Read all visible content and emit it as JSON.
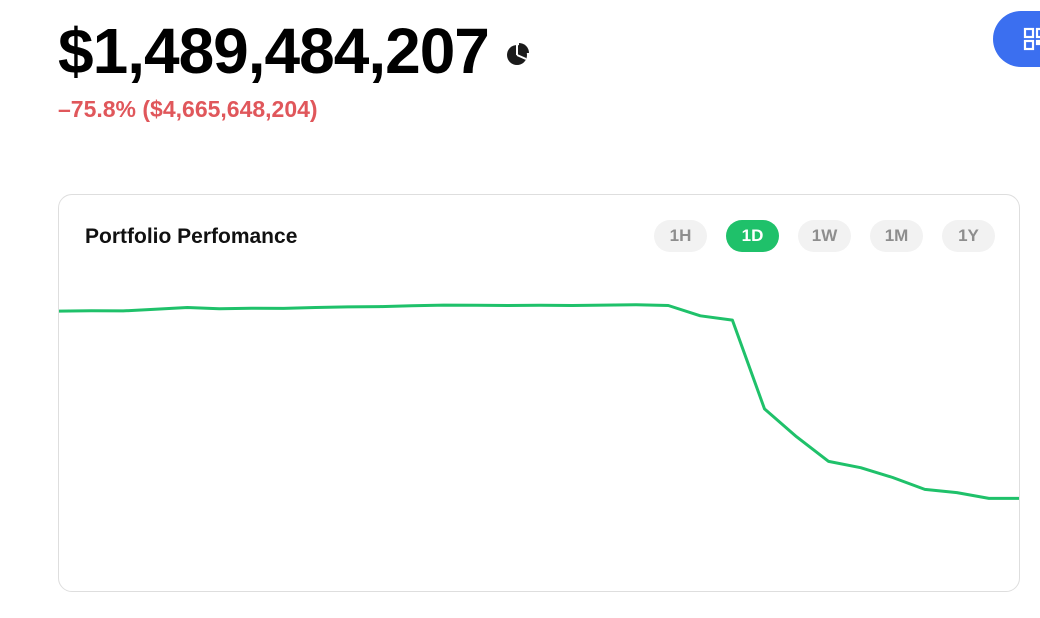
{
  "balance": {
    "value": "$1,489,484,207",
    "change": "–75.8% ($4,665,648,204)",
    "change_color": "#e0575b",
    "breakdown_icon": "pie-chart-icon"
  },
  "qr_button": {
    "icon": "qr-code-icon",
    "color": "#3b6ff0"
  },
  "performance": {
    "title": "Portfolio Perfomance",
    "tabs": [
      {
        "label": "1H",
        "active": false
      },
      {
        "label": "1D",
        "active": true
      },
      {
        "label": "1W",
        "active": false
      },
      {
        "label": "1M",
        "active": false
      },
      {
        "label": "1Y",
        "active": false
      }
    ],
    "active_color": "#1fc16a"
  },
  "chart_data": {
    "type": "line",
    "title": "Portfolio Perfomance",
    "line_color": "#1fc16a",
    "grid": false,
    "ylim": [
      0,
      7000000000
    ],
    "series": [
      {
        "values": [
          6150000000,
          6160000000,
          6155000000,
          6190000000,
          6230000000,
          6205000000,
          6215000000,
          6210000000,
          6230000000,
          6245000000,
          6250000000,
          6270000000,
          6285000000,
          6280000000,
          6275000000,
          6280000000,
          6275000000,
          6285000000,
          6290000000,
          6275000000,
          6045000000,
          5950000000,
          3970000000,
          3350000000,
          2800000000,
          2660000000,
          2440000000,
          2175000000,
          2105000000,
          1975000000,
          1975000000
        ]
      }
    ]
  }
}
